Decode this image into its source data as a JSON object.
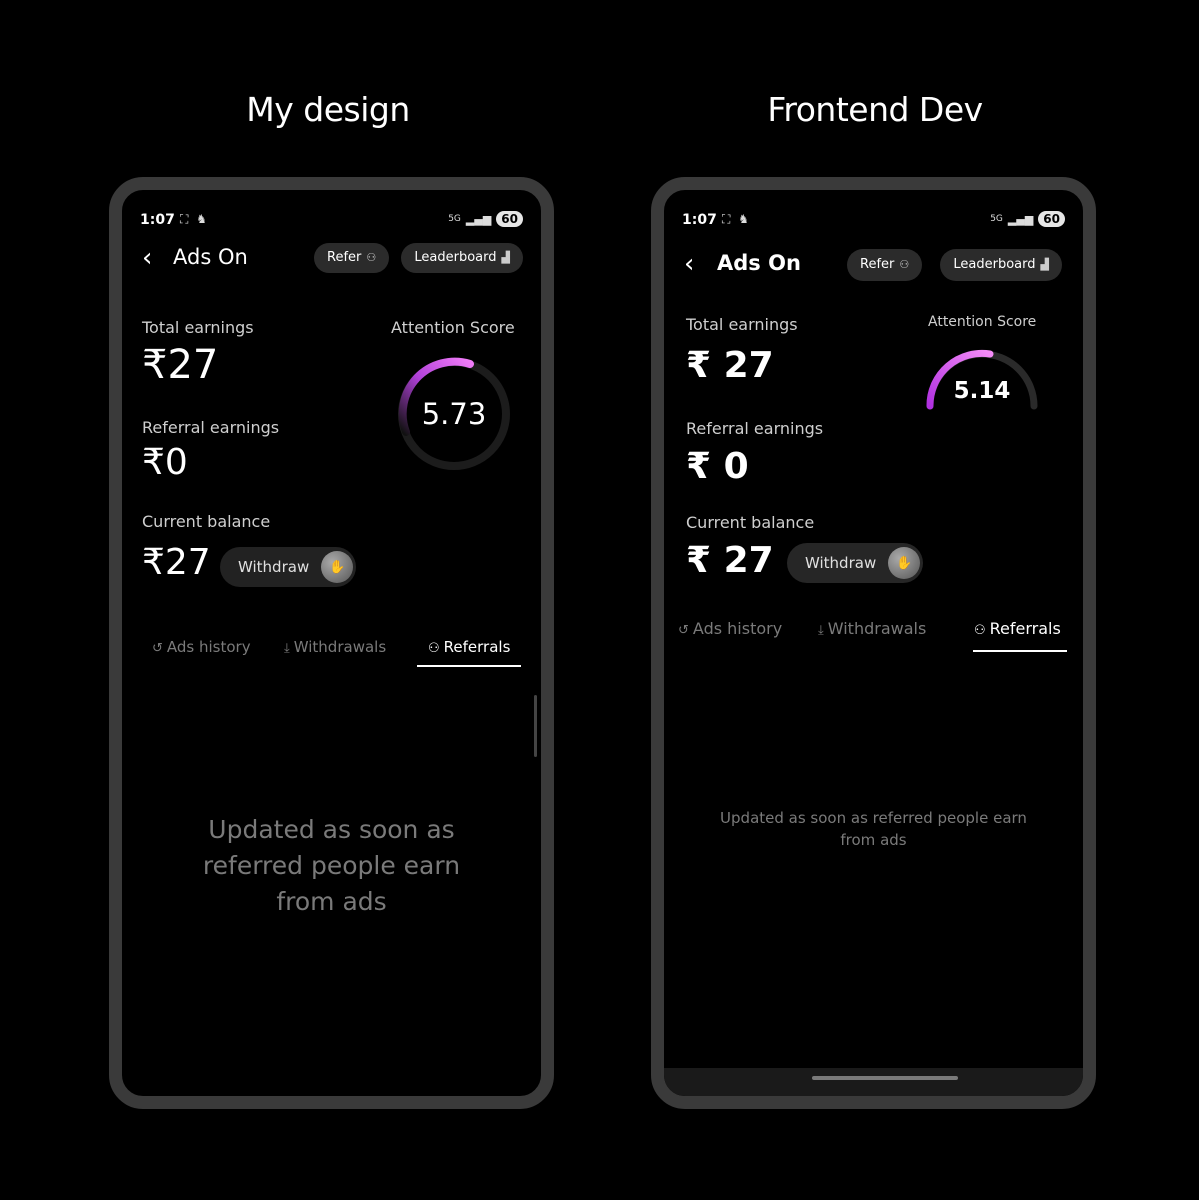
{
  "headings": {
    "left": "My design",
    "right": "Frontend Dev"
  },
  "left_phone": {
    "status": {
      "time": "1:07",
      "icons": "⛶ ♞",
      "network": "5G",
      "battery": "60"
    },
    "title": "Ads On",
    "refer_label": "Refer",
    "leaderboard_label": "Leaderboard",
    "total_earnings_label": "Total earnings",
    "total_earnings_value": "₹27",
    "attention_label": "Attention Score",
    "attention_score": "5.73",
    "referral_label": "Referral earnings",
    "referral_value": "₹0",
    "balance_label": "Current balance",
    "balance_value": "₹27",
    "withdraw_label": "Withdraw",
    "tabs": [
      {
        "label": "Ads history",
        "icon": "history-icon"
      },
      {
        "label": "Withdrawals",
        "icon": "hand-coin-icon"
      },
      {
        "label": "Referrals",
        "icon": "people-icon"
      }
    ],
    "empty_line1": "Updated as soon as",
    "empty_line2": "referred people earn",
    "empty_line3": "from ads"
  },
  "right_phone": {
    "status": {
      "time": "1:07",
      "icons": "⛶ ♞",
      "network": "5G",
      "battery": "60"
    },
    "title": "Ads On",
    "refer_label": "Refer",
    "leaderboard_label": "Leaderboard",
    "total_earnings_label": "Total earnings",
    "total_earnings_value": "₹ 27",
    "attention_label": "Attention Score",
    "attention_score": "5.14",
    "referral_label": "Referral earnings",
    "referral_value": "₹ 0",
    "balance_label": "Current balance",
    "balance_value": "₹ 27",
    "withdraw_label": "Withdraw",
    "tabs": [
      {
        "label": "Ads history",
        "icon": "history-icon"
      },
      {
        "label": "Withdrawals",
        "icon": "hand-coin-icon"
      },
      {
        "label": "Referrals",
        "icon": "people-icon"
      }
    ],
    "empty_line1": "Updated as soon as referred people earn",
    "empty_line2": "from ads"
  },
  "colors": {
    "accent_magenta": "#e040fb",
    "chip_bg": "#2b2b2b",
    "frame": "#3a3a3a"
  }
}
